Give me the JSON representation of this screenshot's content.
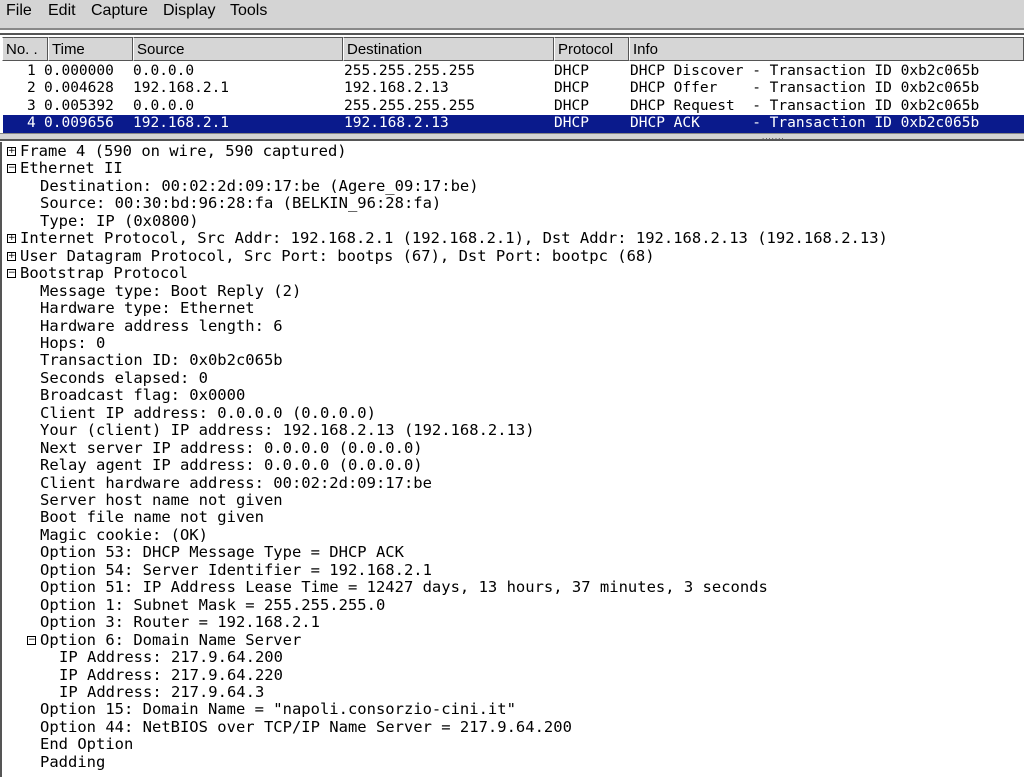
{
  "menu": [
    "File",
    "Edit",
    "Capture",
    "Display",
    "Tools"
  ],
  "columns": [
    "No. .",
    "Time",
    "Source",
    "Destination",
    "Protocol",
    "Info"
  ],
  "packets": [
    {
      "no": "1",
      "time": "0.000000",
      "src": "0.0.0.0",
      "dst": "255.255.255.255",
      "proto": "DHCP",
      "info": "DHCP Discover - Transaction ID 0xb2c065b",
      "selected": false
    },
    {
      "no": "2",
      "time": "0.004628",
      "src": "192.168.2.1",
      "dst": "192.168.2.13",
      "proto": "DHCP",
      "info": "DHCP Offer    - Transaction ID 0xb2c065b",
      "selected": false
    },
    {
      "no": "3",
      "time": "0.005392",
      "src": "0.0.0.0",
      "dst": "255.255.255.255",
      "proto": "DHCP",
      "info": "DHCP Request  - Transaction ID 0xb2c065b",
      "selected": false
    },
    {
      "no": "4",
      "time": "0.009656",
      "src": "192.168.2.1",
      "dst": "192.168.2.13",
      "proto": "DHCP",
      "info": "DHCP ACK      - Transaction ID 0xb2c065b",
      "selected": true
    }
  ],
  "selection_color": "#0a1a8c",
  "tree": [
    {
      "t": "Frame 4 (590 on wire, 590 captured)",
      "l": 0,
      "e": "+"
    },
    {
      "t": "Ethernet II",
      "l": 0,
      "e": "-"
    },
    {
      "t": "Destination: 00:02:2d:09:17:be (Agere_09:17:be)",
      "l": 1
    },
    {
      "t": "Source: 00:30:bd:96:28:fa (BELKIN_96:28:fa)",
      "l": 1
    },
    {
      "t": "Type: IP (0x0800)",
      "l": 1
    },
    {
      "t": "Internet Protocol, Src Addr: 192.168.2.1 (192.168.2.1), Dst Addr: 192.168.2.13 (192.168.2.13)",
      "l": 0,
      "e": "+"
    },
    {
      "t": "User Datagram Protocol, Src Port: bootps (67), Dst Port: bootpc (68)",
      "l": 0,
      "e": "+"
    },
    {
      "t": "Bootstrap Protocol",
      "l": 0,
      "e": "-"
    },
    {
      "t": "Message type: Boot Reply (2)",
      "l": 1
    },
    {
      "t": "Hardware type: Ethernet",
      "l": 1
    },
    {
      "t": "Hardware address length: 6",
      "l": 1
    },
    {
      "t": "Hops: 0",
      "l": 1
    },
    {
      "t": "Transaction ID: 0x0b2c065b",
      "l": 1
    },
    {
      "t": "Seconds elapsed: 0",
      "l": 1
    },
    {
      "t": "Broadcast flag: 0x0000",
      "l": 1
    },
    {
      "t": "Client IP address: 0.0.0.0 (0.0.0.0)",
      "l": 1
    },
    {
      "t": "Your (client) IP address: 192.168.2.13 (192.168.2.13)",
      "l": 1
    },
    {
      "t": "Next server IP address: 0.0.0.0 (0.0.0.0)",
      "l": 1
    },
    {
      "t": "Relay agent IP address: 0.0.0.0 (0.0.0.0)",
      "l": 1
    },
    {
      "t": "Client hardware address: 00:02:2d:09:17:be",
      "l": 1
    },
    {
      "t": "Server host name not given",
      "l": 1
    },
    {
      "t": "Boot file name not given",
      "l": 1
    },
    {
      "t": "Magic cookie: (OK)",
      "l": 1
    },
    {
      "t": "Option 53: DHCP Message Type = DHCP ACK",
      "l": 1
    },
    {
      "t": "Option 54: Server Identifier = 192.168.2.1",
      "l": 1
    },
    {
      "t": "Option 51: IP Address Lease Time = 12427 days, 13 hours, 37 minutes, 3 seconds",
      "l": 1
    },
    {
      "t": "Option 1: Subnet Mask = 255.255.255.0",
      "l": 1
    },
    {
      "t": "Option 3: Router = 192.168.2.1",
      "l": 1
    },
    {
      "t": "Option 6: Domain Name Server",
      "l": 1,
      "e": "-"
    },
    {
      "t": "IP Address: 217.9.64.200",
      "l": 2
    },
    {
      "t": "IP Address: 217.9.64.220",
      "l": 2
    },
    {
      "t": "IP Address: 217.9.64.3",
      "l": 2
    },
    {
      "t": "Option 15: Domain Name = \"napoli.consorzio-cini.it\"",
      "l": 1
    },
    {
      "t": "Option 44: NetBIOS over TCP/IP Name Server = 217.9.64.200",
      "l": 1
    },
    {
      "t": "End Option",
      "l": 1
    },
    {
      "t": "Padding",
      "l": 1
    }
  ]
}
